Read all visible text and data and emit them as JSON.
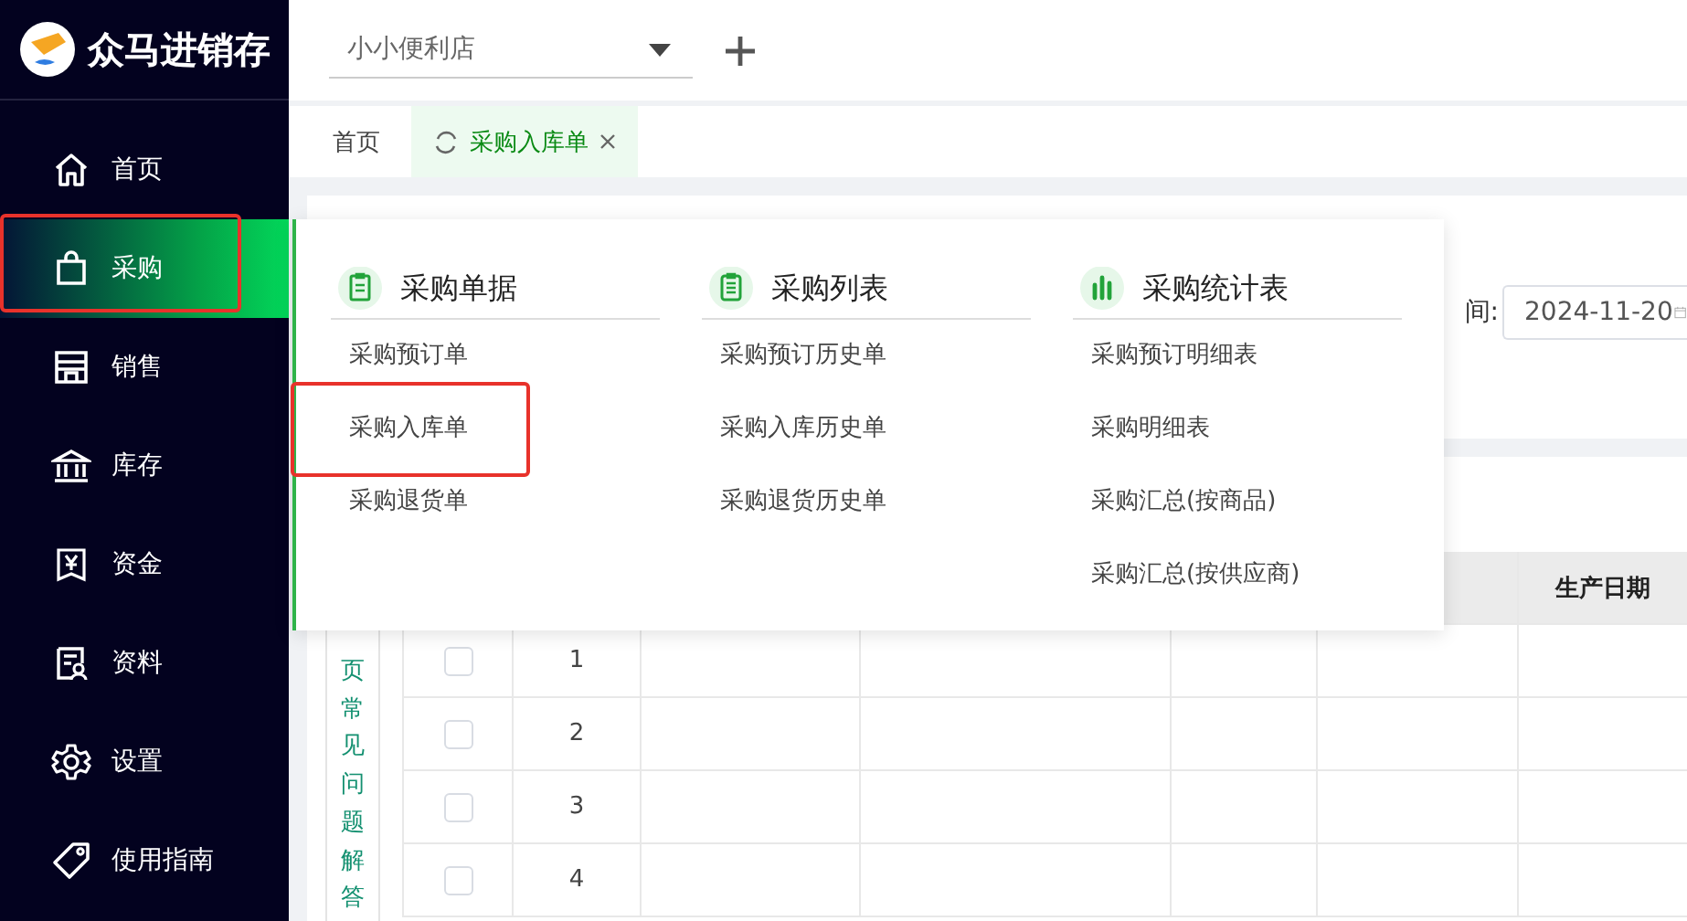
{
  "app": {
    "name": "众马进销存"
  },
  "nav": [
    {
      "label": "首页",
      "selected": false,
      "highlighted": false
    },
    {
      "label": "采购",
      "selected": true,
      "highlighted": true
    },
    {
      "label": "销售",
      "selected": false,
      "highlighted": false
    },
    {
      "label": "库存",
      "selected": false,
      "highlighted": false
    },
    {
      "label": "资金",
      "selected": false,
      "highlighted": false
    },
    {
      "label": "资料",
      "selected": false,
      "highlighted": false
    },
    {
      "label": "设置",
      "selected": false,
      "highlighted": false
    },
    {
      "label": "使用指南",
      "selected": false,
      "highlighted": false
    }
  ],
  "store_select": {
    "value": "小小便利店"
  },
  "tabs": [
    {
      "label": "首页",
      "selected": false,
      "closable": false
    },
    {
      "label": "采购入库单",
      "selected": true,
      "closable": true
    }
  ],
  "filter": {
    "label": "间:",
    "date": "2024-11-20"
  },
  "faq_link": "页常见问题解答",
  "table": {
    "header": "生产日期",
    "rows": [
      {
        "index": "1",
        "checked": false
      },
      {
        "index": "2",
        "checked": false
      },
      {
        "index": "3",
        "checked": false
      },
      {
        "index": "4",
        "checked": false
      }
    ]
  },
  "dropdown": {
    "columns": [
      {
        "title": "采购单据",
        "items": [
          {
            "label": "采购预订单",
            "highlighted": false
          },
          {
            "label": "采购入库单",
            "highlighted": true
          },
          {
            "label": "采购退货单",
            "highlighted": false
          }
        ]
      },
      {
        "title": "采购列表",
        "items": [
          {
            "label": "采购预订历史单",
            "highlighted": false
          },
          {
            "label": "采购入库历史单",
            "highlighted": false
          },
          {
            "label": "采购退货历史单",
            "highlighted": false
          }
        ]
      },
      {
        "title": "采购统计表",
        "items": [
          {
            "label": "采购预订明细表",
            "highlighted": false
          },
          {
            "label": "采购明细表",
            "highlighted": false
          },
          {
            "label": "采购汇总(按商品)",
            "highlighted": false
          },
          {
            "label": "采购汇总(按供应商)",
            "highlighted": false
          }
        ]
      }
    ]
  }
}
